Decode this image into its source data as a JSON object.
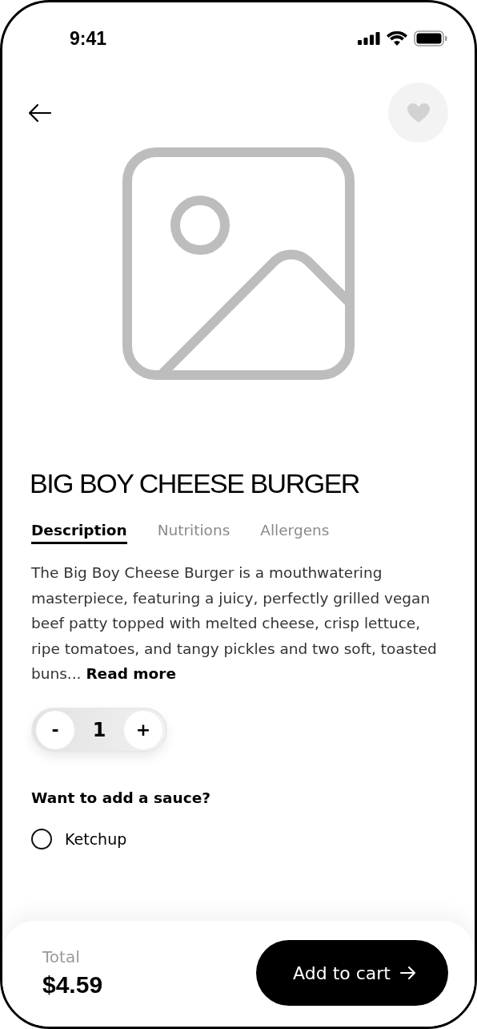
{
  "status_bar": {
    "time": "9:41"
  },
  "favorite": false,
  "product": {
    "title": "BIG BOY CHEESE BURGER"
  },
  "tabs": [
    {
      "label": "Description",
      "selected": true
    },
    {
      "label": "Nutritions",
      "selected": false
    },
    {
      "label": "Allergens",
      "selected": false
    }
  ],
  "description": {
    "text": "The Big Boy Cheese Burger is a mouthwatering masterpiece, featuring a juicy, perfectly grilled vegan beef patty topped with melted cheese, crisp lettuce, ripe tomatoes, and tangy pickles and two soft, toasted buns...",
    "link": "Read more"
  },
  "quantity": {
    "minus": "-",
    "value": "1",
    "plus": "+"
  },
  "sauce": {
    "heading": "Want to add a sauce?",
    "options": [
      {
        "label": "Ketchup",
        "selected": false
      }
    ]
  },
  "footer": {
    "total_label": "Total",
    "total": "$4.59",
    "button": "Add to cart"
  }
}
